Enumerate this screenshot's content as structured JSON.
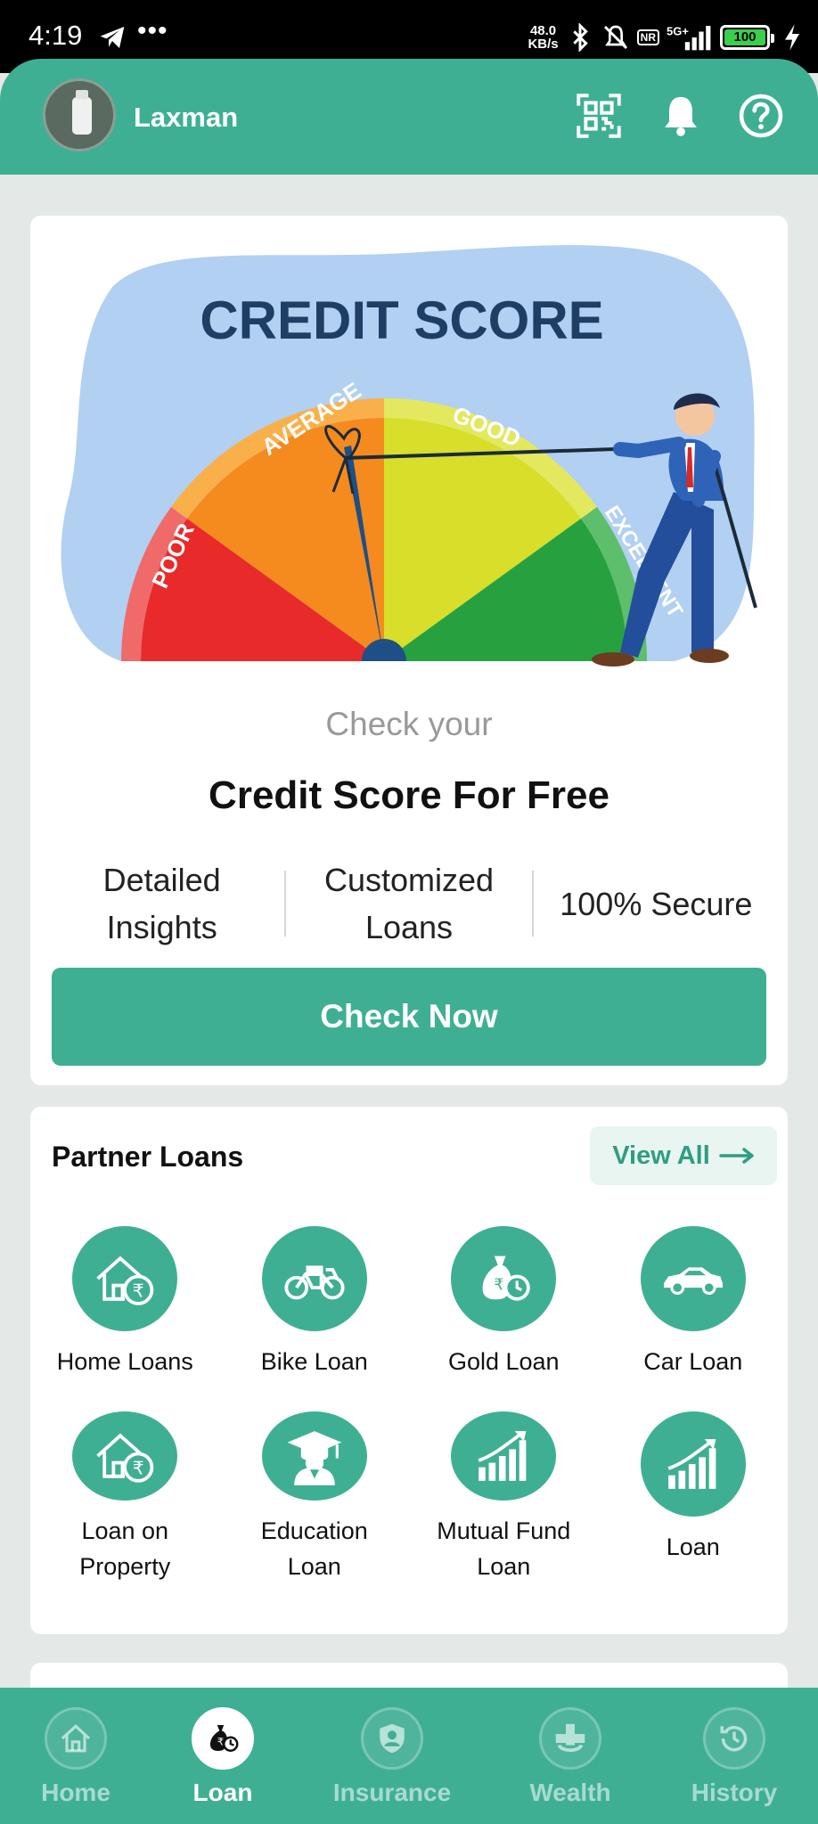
{
  "status_bar": {
    "time": "4:19",
    "more": "•••",
    "net_speed_value": "48.0",
    "net_speed_unit": "KB/s",
    "network_badge": "NR",
    "network_type": "5G+",
    "battery_level": "100",
    "icons": [
      "telegram-icon",
      "bluetooth-icon",
      "vibrate-off-icon",
      "signal-icon",
      "battery-icon",
      "charging-icon"
    ]
  },
  "header": {
    "username": "Laxman",
    "icons": [
      "qr-scan-icon",
      "bell-icon",
      "help-icon"
    ]
  },
  "credit_card": {
    "banner": {
      "title": "CREDIT SCORE",
      "segments": [
        "POOR",
        "AVERAGE",
        "GOOD",
        "EXCELLENT"
      ]
    },
    "subtitle": "Check your",
    "title": "Credit Score For Free",
    "features": [
      "Detailed\nInsights",
      "Customized\nLoans",
      "100% Secure"
    ],
    "cta": "Check Now"
  },
  "partner_loans": {
    "title": "Partner Loans",
    "view_all": "View All",
    "items": [
      {
        "label": "Home Loans",
        "icon": "home-loan-icon"
      },
      {
        "label": "Bike Loan",
        "icon": "bike-icon"
      },
      {
        "label": "Gold Loan",
        "icon": "gold-bag-icon"
      },
      {
        "label": "Car Loan",
        "icon": "car-icon"
      },
      {
        "label": "Loan on\nProperty",
        "icon": "property-loan-icon"
      },
      {
        "label": "Education\nLoan",
        "icon": "graduate-icon"
      },
      {
        "label": "Mutual Fund\nLoan",
        "icon": "growth-chart-icon"
      },
      {
        "label": "Loan",
        "icon": "growth-chart-icon"
      }
    ]
  },
  "bottom_nav": {
    "active": "Loan",
    "items": [
      {
        "label": "Home",
        "icon": "home-icon"
      },
      {
        "label": "Loan",
        "icon": "money-bag-icon"
      },
      {
        "label": "Insurance",
        "icon": "shield-person-icon"
      },
      {
        "label": "Wealth",
        "icon": "medical-cross-icon"
      },
      {
        "label": "History",
        "icon": "history-icon"
      }
    ]
  },
  "colors": {
    "primary": "#3faf94",
    "background": "#e4e8e7",
    "view_all_bg": "#e8f5f1"
  }
}
